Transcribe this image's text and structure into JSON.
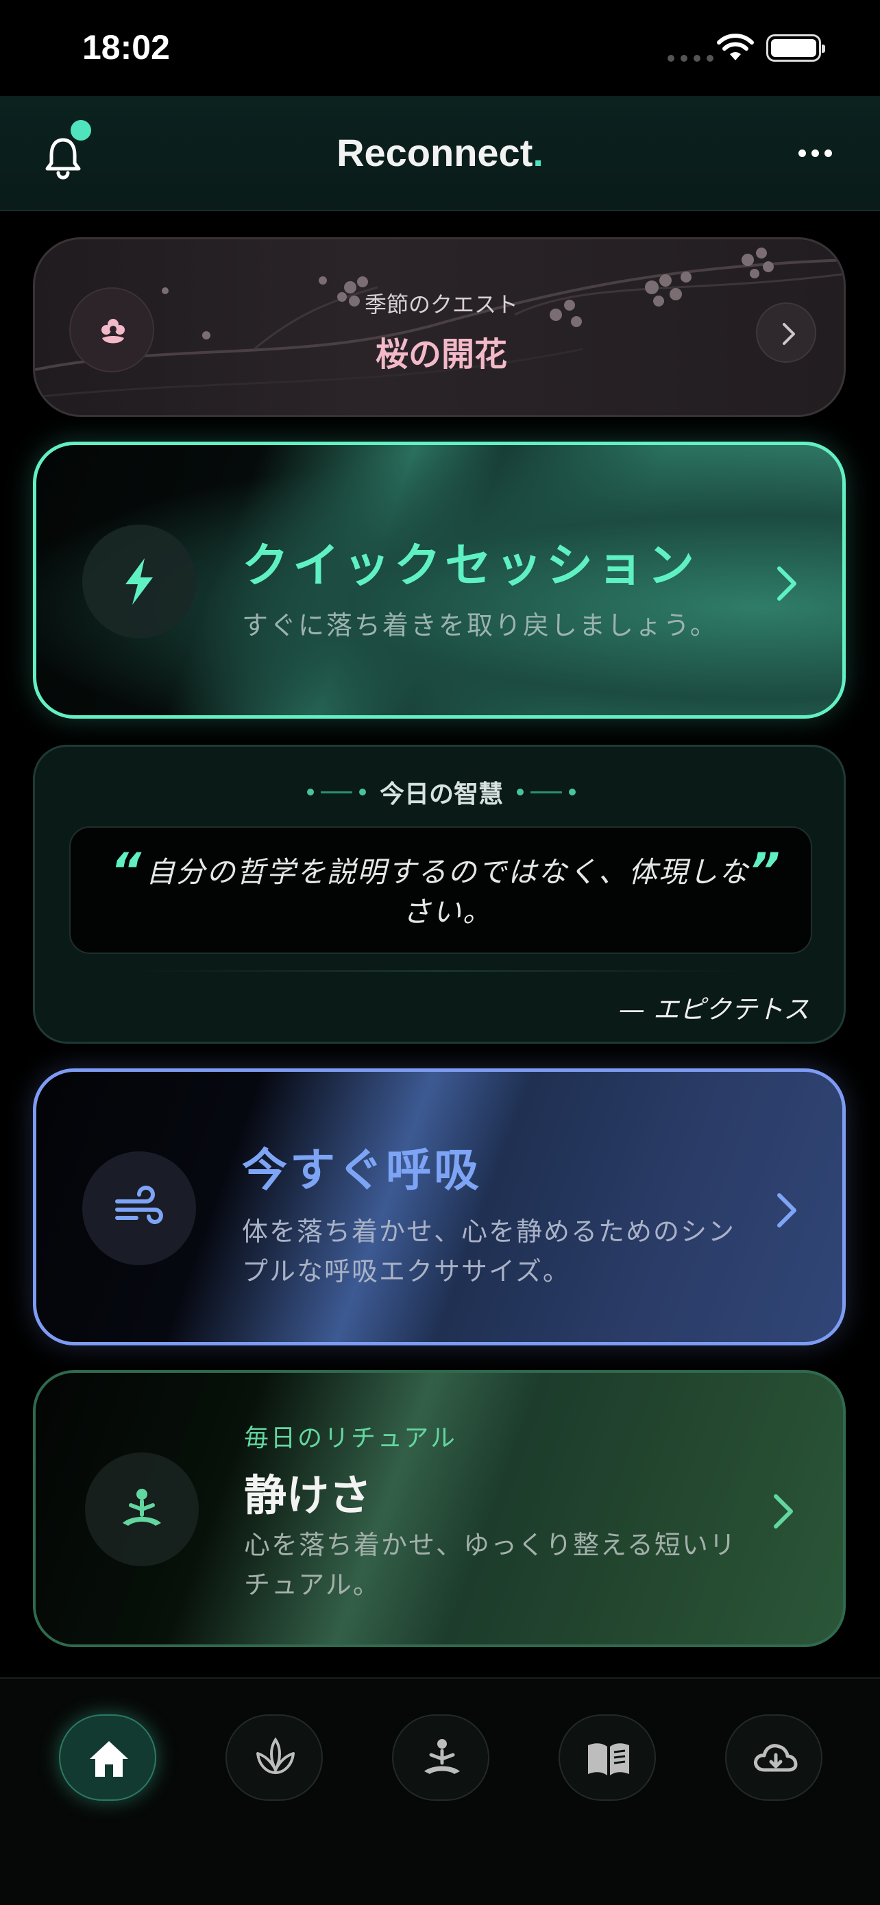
{
  "status_bar": {
    "time": "18:02"
  },
  "header": {
    "title": "Reconnect",
    "title_dot": "."
  },
  "quest": {
    "subtitle": "季節のクエスト",
    "title": "桜の開花"
  },
  "quick_session": {
    "title": "クイックセッション",
    "subtitle": "すぐに落ち着きを取り戻しましょう。",
    "accent": "#5ff1c2"
  },
  "wisdom": {
    "label": "今日の智慧",
    "quote_open": "“",
    "quote_close": "”",
    "quote": "自分の哲学を説明するのではなく、体現しなさい。",
    "author": "— エピクテトス"
  },
  "breathe": {
    "title": "今すぐ呼吸",
    "subtitle": "体を落ち着かせ、心を静めるためのシンプルな呼吸エクササイズ。",
    "accent": "#7ea4f5"
  },
  "ritual": {
    "kicker": "毎日のリチュアル",
    "title": "静けさ",
    "subtitle": "心を落ち着かせ、ゆっくり整える短いリチュアル。",
    "accent": "#63d6a0"
  },
  "tabbar": {
    "items": [
      {
        "icon": "home-icon",
        "active": true
      },
      {
        "icon": "lotus-icon",
        "active": false
      },
      {
        "icon": "meditation-icon",
        "active": false
      },
      {
        "icon": "book-icon",
        "active": false
      },
      {
        "icon": "cloud-download-icon",
        "active": false
      }
    ]
  }
}
